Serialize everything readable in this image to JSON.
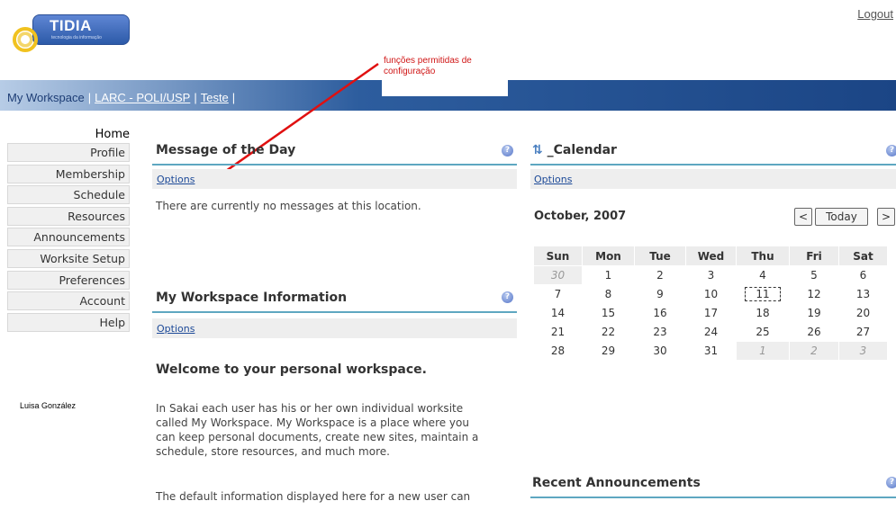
{
  "header": {
    "logo_text": "TIDIA",
    "logo_subtitle": "tecnologia da informação",
    "logout": "Logout"
  },
  "tabs": [
    {
      "label": "My Workspace",
      "current": true
    },
    {
      "label": "LARC - POLI/USP",
      "current": false
    },
    {
      "label": "Teste",
      "current": false
    }
  ],
  "annotation": {
    "line1": "funções permitidas de",
    "line2": "configuração",
    "color": "#d01515"
  },
  "sidebar": {
    "home": "Home",
    "items": [
      {
        "label": "Profile"
      },
      {
        "label": "Membership"
      },
      {
        "label": "Schedule"
      },
      {
        "label": "Resources"
      },
      {
        "label": "Announcements"
      },
      {
        "label": "Worksite Setup"
      },
      {
        "label": "Preferences"
      },
      {
        "label": "Account"
      },
      {
        "label": "Help"
      }
    ],
    "user": "Luisa González"
  },
  "motd": {
    "title": "Message of the Day",
    "options": "Options",
    "message": "There are currently no messages at this location."
  },
  "workspace_info": {
    "title": "My Workspace Information",
    "options": "Options",
    "heading": "Welcome to your personal workspace.",
    "para1_l1": "In Sakai each user has his or her own individual worksite",
    "para1_l2": "called My Workspace. My Workspace is a place where you",
    "para1_l3": "can keep personal documents, create new sites, maintain a",
    "para1_l4": "schedule, store resources, and much more.",
    "para2_l1": "The default information displayed here for a new user can"
  },
  "calendar": {
    "title": "_Calendar",
    "options": "Options",
    "month": "October, 2007",
    "prev": "<",
    "today": "Today",
    "next": ">",
    "days": [
      "Sun",
      "Mon",
      "Tue",
      "Wed",
      "Thu",
      "Fri",
      "Sat"
    ],
    "weeks": [
      [
        {
          "d": "30",
          "o": true
        },
        {
          "d": "1"
        },
        {
          "d": "2"
        },
        {
          "d": "3"
        },
        {
          "d": "4"
        },
        {
          "d": "5"
        },
        {
          "d": "6"
        }
      ],
      [
        {
          "d": "7"
        },
        {
          "d": "8"
        },
        {
          "d": "9"
        },
        {
          "d": "10"
        },
        {
          "d": "11",
          "today": true
        },
        {
          "d": "12"
        },
        {
          "d": "13"
        }
      ],
      [
        {
          "d": "14"
        },
        {
          "d": "15"
        },
        {
          "d": "16"
        },
        {
          "d": "17"
        },
        {
          "d": "18"
        },
        {
          "d": "19"
        },
        {
          "d": "20"
        }
      ],
      [
        {
          "d": "21"
        },
        {
          "d": "22"
        },
        {
          "d": "23"
        },
        {
          "d": "24"
        },
        {
          "d": "25"
        },
        {
          "d": "26"
        },
        {
          "d": "27"
        }
      ],
      [
        {
          "d": "28"
        },
        {
          "d": "29"
        },
        {
          "d": "30"
        },
        {
          "d": "31"
        },
        {
          "d": "1",
          "o": true
        },
        {
          "d": "2",
          "o": true
        },
        {
          "d": "3",
          "o": true
        }
      ]
    ]
  },
  "announcements": {
    "title": "Recent Announcements"
  }
}
